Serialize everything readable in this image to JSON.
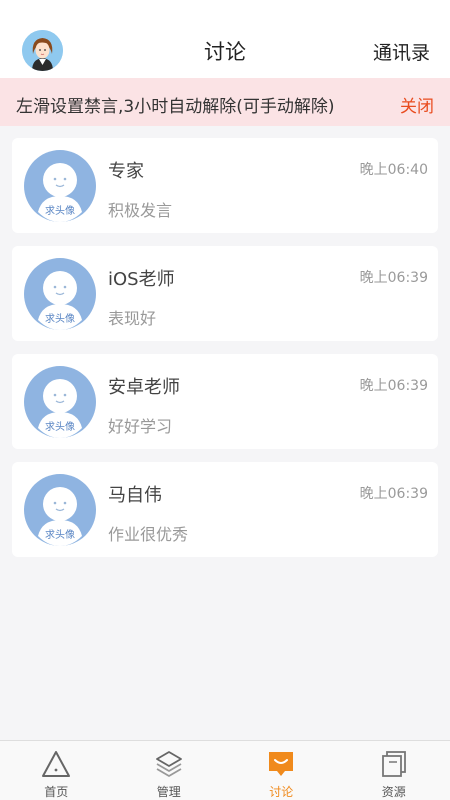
{
  "header": {
    "title": "讨论",
    "contacts_label": "通讯录"
  },
  "notice": {
    "text": "左滑设置禁言,3小时自动解除(可手动解除)",
    "close_label": "关闭"
  },
  "conversations": [
    {
      "name": "专家",
      "time": "晚上06:40",
      "message": "积极发言",
      "avatar_text": "求头像"
    },
    {
      "name": "iOS老师",
      "time": "晚上06:39",
      "message": "表现好",
      "avatar_text": "求头像"
    },
    {
      "name": "安卓老师",
      "time": "晚上06:39",
      "message": "好好学习",
      "avatar_text": "求头像"
    },
    {
      "name": "马自伟",
      "time": "晚上06:39",
      "message": "作业很优秀",
      "avatar_text": "求头像"
    }
  ],
  "tabs": [
    {
      "label": "首页",
      "icon": "triangle-home-icon"
    },
    {
      "label": "管理",
      "icon": "layers-icon"
    },
    {
      "label": "讨论",
      "icon": "chat-bubble-icon",
      "active": true
    },
    {
      "label": "资源",
      "icon": "documents-icon"
    }
  ],
  "colors": {
    "accent": "#f08a1c",
    "notice_bg": "#fbe3e5",
    "close_text": "#e94c1f",
    "avatar_blue": "#8fb4e1"
  }
}
